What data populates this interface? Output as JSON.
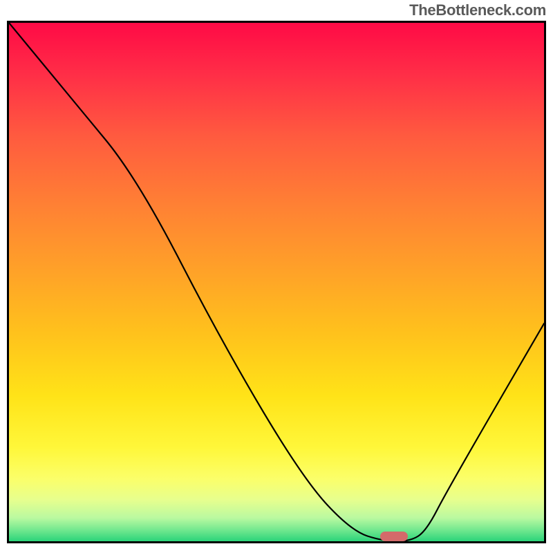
{
  "watermark": "TheBottleneck.com",
  "chart_data": {
    "type": "line",
    "title": "",
    "xlabel": "",
    "ylabel": "",
    "xlim": [
      0,
      100
    ],
    "ylim": [
      0,
      100
    ],
    "grid": false,
    "legend": false,
    "series": [
      {
        "name": "bottleneck-curve",
        "color": "#000000",
        "x": [
          0,
          12,
          24,
          40,
          55,
          64,
          70,
          75,
          78,
          82,
          100
        ],
        "y": [
          100,
          85,
          70,
          38,
          12,
          2,
          0,
          0,
          2,
          10,
          42
        ]
      }
    ],
    "annotations": [
      {
        "type": "marker",
        "shape": "pill",
        "x": 72,
        "y": 0,
        "color": "#d46a6a"
      }
    ],
    "background_gradient": {
      "stops": [
        {
          "pos": 0.0,
          "color": "#ff0a46"
        },
        {
          "pos": 0.1,
          "color": "#ff2e47"
        },
        {
          "pos": 0.22,
          "color": "#ff5b3f"
        },
        {
          "pos": 0.35,
          "color": "#ff8034"
        },
        {
          "pos": 0.48,
          "color": "#ffa228"
        },
        {
          "pos": 0.6,
          "color": "#ffc21c"
        },
        {
          "pos": 0.72,
          "color": "#ffe318"
        },
        {
          "pos": 0.82,
          "color": "#fff73a"
        },
        {
          "pos": 0.88,
          "color": "#fbff6a"
        },
        {
          "pos": 0.92,
          "color": "#e7ff8e"
        },
        {
          "pos": 0.955,
          "color": "#baf9a0"
        },
        {
          "pos": 0.978,
          "color": "#73e88f"
        },
        {
          "pos": 1.0,
          "color": "#2bd47a"
        }
      ]
    }
  }
}
